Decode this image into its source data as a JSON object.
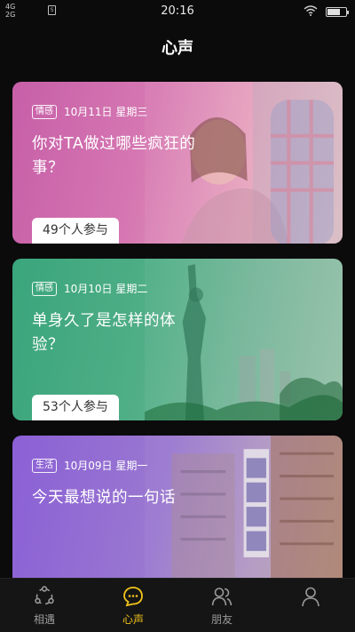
{
  "status_bar": {
    "network_top": "4G",
    "network_bottom": "2G",
    "sim_label": "S",
    "time": "20:16",
    "wifi_icon": "wifi-icon",
    "battery_icon": "battery-icon"
  },
  "header": {
    "title": "心声"
  },
  "cards": [
    {
      "tag": "情感",
      "date": "10月11日 星期三",
      "title": "你对TA做过哪些疯狂的事？",
      "participants": "49个人参与",
      "art": "couple-photo"
    },
    {
      "tag": "情感",
      "date": "10月10日 星期二",
      "title": "单身久了是怎样的体验？",
      "participants": "53个人参与",
      "art": "statue-of-liberty-photo"
    },
    {
      "tag": "生活",
      "date": "10月09日 星期一",
      "title": "今天最想说的一句话",
      "participants": "",
      "art": "street-signs-photo"
    }
  ],
  "bottom_nav": {
    "items": [
      {
        "label": "相遇",
        "icon": "share-icon",
        "active": false
      },
      {
        "label": "心声",
        "icon": "chat-bubble-icon",
        "active": true
      },
      {
        "label": "朋友",
        "icon": "friends-icon",
        "active": false
      },
      {
        "label": "",
        "icon": "profile-icon",
        "active": false
      }
    ],
    "active_color": "#f2c41b",
    "inactive_color": "#9a9a9a"
  }
}
